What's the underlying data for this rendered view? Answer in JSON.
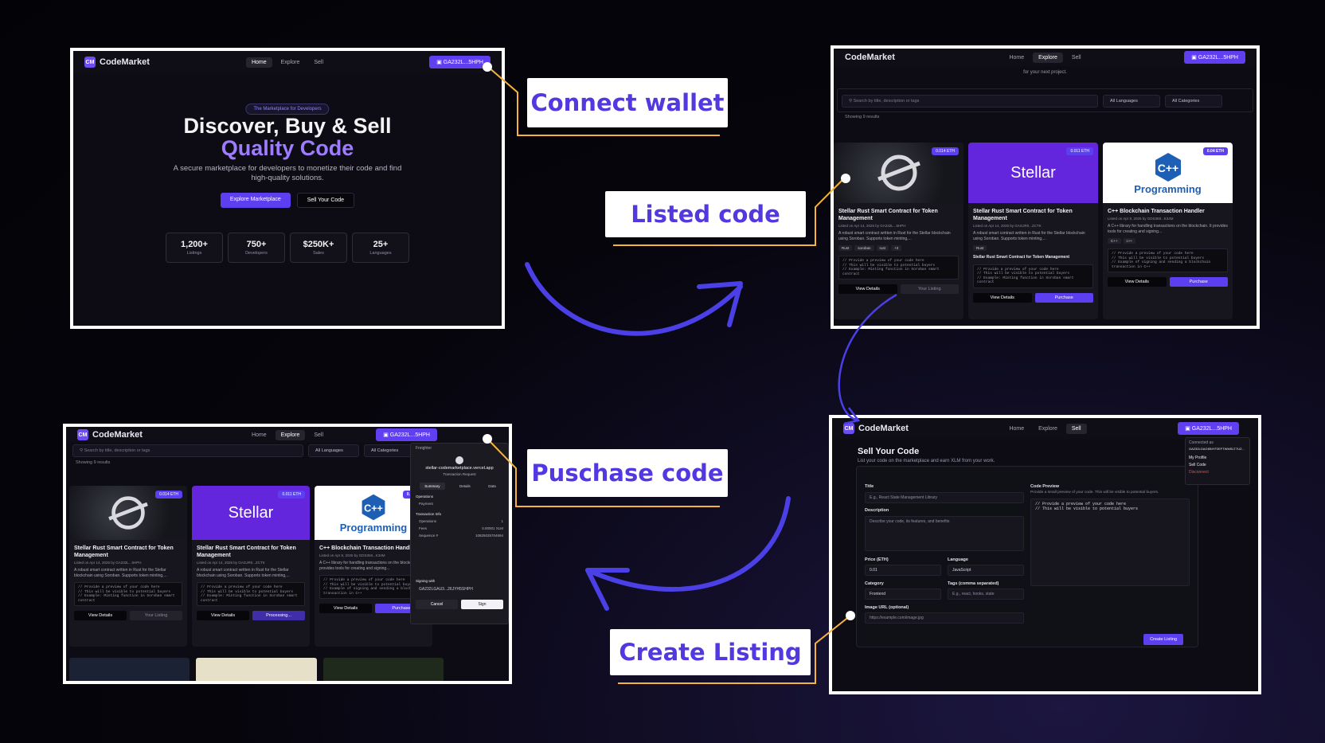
{
  "brand": {
    "name": "CodeMarket",
    "badge": "CM"
  },
  "nav": {
    "home": "Home",
    "explore": "Explore",
    "sell": "Sell",
    "wallet": "GA232L...5HPH"
  },
  "home": {
    "tag": "The Marketplace for Developers",
    "title_line1": "Discover, Buy & Sell",
    "title_line2": "Quality Code",
    "subtitle": "A secure marketplace for developers to monetize their code and find high-quality solutions.",
    "explore_btn": "Explore Marketplace",
    "sell_btn": "Sell Your Code",
    "stats": [
      {
        "value": "1,200+",
        "label": "Listings"
      },
      {
        "value": "750+",
        "label": "Developers"
      },
      {
        "value": "$250K+",
        "label": "Sales"
      },
      {
        "value": "25+",
        "label": "Languages"
      }
    ]
  },
  "explore": {
    "intro": "for your next project.",
    "search_placeholder": "Search by title, description or tags",
    "languages": "All Languages",
    "categories": "All Categories",
    "showing": "Showing 9 results",
    "cards": [
      {
        "price": "0.014 ETH",
        "title": "Stellar Rust Smart Contract for Token Management",
        "meta": "Listed on Apr 14, 2025 by GA232L...5HPH",
        "desc": "A robust smart contract written in Rust for the Stellar blockchain using Soroban. Supports token minting,...",
        "tags": [
          "Rust",
          "soroban",
          "rust",
          "+3"
        ],
        "code": "// Provide a preview of your code here\n// This will be visible to potential buyers\n// Example: Minting function in Soroban smart\ncontract",
        "view": "View Details",
        "action": "Your Listing"
      },
      {
        "price": "0.011 ETH",
        "img_text": "Stellar",
        "title": "Stellar Rust Smart Contract for Token Management",
        "meta": "Listed on Apr 14, 2025 by GAGJR0...ZCTK",
        "desc": "A robust smart contract written in Rust for the Stellar blockchain using Soroban. Supports token minting,...",
        "tags": [
          "Rust"
        ],
        "subtitle": "Stellar Rust Smart Contract for Token Management",
        "code": "// Provide a preview of your code here\n// This will be visible to potential buyers\n// Example: Minting function in Soroban smart\ncontract",
        "view": "View Details",
        "action": "Purchase"
      },
      {
        "price": "0.04 ETH",
        "img_text": "Programming",
        "title": "C++ Blockchain Transaction Handler",
        "meta": "Listed on Apr 8, 2025 by GDS3MI...K34M",
        "desc": "A C++ library for handling transactions on the blockchain. It provides tools for creating and signing...",
        "tags": [
          "C++",
          "c++"
        ],
        "code": "// Provide a preview of your code here\n// This will be visible to potential buyers\n// Example of signing and sending a blockchain\ntransaction in C++",
        "view": "View Details",
        "action": "Purchase"
      }
    ]
  },
  "sell": {
    "title": "Sell Your Code",
    "subtitle": "List your code on the marketplace and earn XLM from your work.",
    "f_title": "Title",
    "f_title_ph": "E.g., React State Management Library",
    "f_desc": "Description",
    "f_desc_ph": "Describe your code, its features, and benefits",
    "f_price": "Price (ETH)",
    "f_price_val": "0.01",
    "f_lang": "Language",
    "f_lang_val": "JavaScript",
    "f_cat": "Category",
    "f_cat_val": "Frontend",
    "f_tags": "Tags (comma separated)",
    "f_tags_ph": "E.g., react, hooks, state",
    "f_img": "Image URL (optional)",
    "f_img_ph": "https://example.com/image.jpg",
    "preview_label": "Code Preview",
    "preview_help": "Provide a small preview of your code. This will be visible to potential buyers.",
    "preview_code": "// Provide a preview of your code here\n// This will be visible to potential buyers",
    "create_btn": "Create Listing",
    "menu": {
      "connected_as": "Connected as",
      "address": "GA232LGAGI5NYF2EFTWMSLT7UZ...",
      "profile": "My Profile",
      "sell_code": "Sell Code",
      "disconnect": "Disconnect"
    }
  },
  "wallet_popup": {
    "app": "Freighter",
    "site": "stellar-codemarketplace.vercel.app",
    "request": "Transaction Request",
    "tabs": [
      "Summary",
      "Details",
      "Data"
    ],
    "operations_h": "Operations",
    "payment": "Payment",
    "tx_info": "Transaction Info",
    "rows": [
      {
        "label": "Operations",
        "value": "1"
      },
      {
        "label": "Fees",
        "value": "0.00001 XLM"
      },
      {
        "label": "Sequence #",
        "value": "10825025704694"
      }
    ],
    "signing_with": "Signing with",
    "account": "GA232LGAU3...26JYH5SHPH",
    "cancel": "Cancel",
    "sign": "Sign"
  },
  "bottom_left": {
    "processing": "Processing..."
  },
  "callouts": {
    "connect": "Connect wallet",
    "listed": "Listed code",
    "purchase": "Puschase code",
    "create": "Create Listing"
  },
  "colors": {
    "accent": "#5b3ff0",
    "callout_text": "#5238e0",
    "connector": "#f5b33a",
    "arrow": "#4b3fe6"
  }
}
